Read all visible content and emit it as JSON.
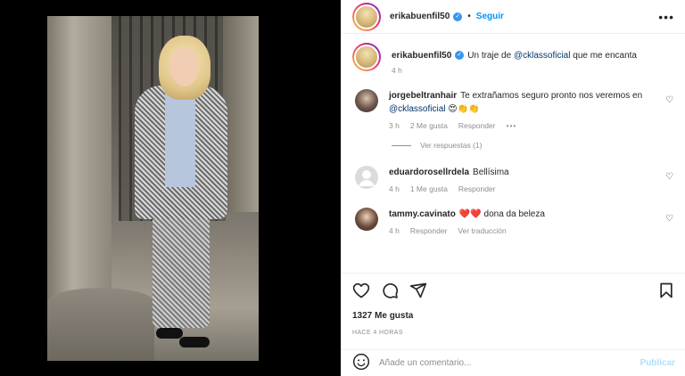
{
  "colors": {
    "accent": "#0095f6",
    "mention": "#00376b",
    "muted": "#8e8e8e",
    "heart_red": "#ed4956"
  },
  "header": {
    "username": "erikabuenfil50",
    "follow_label": "Seguir",
    "more_icon": "more-horizontal-icon"
  },
  "caption": {
    "username": "erikabuenfil50",
    "text_before": "Un traje de ",
    "mention": "@cklassoficial",
    "text_after": " que me encanta",
    "time": "4 h"
  },
  "comments": [
    {
      "username": "jorgebeltranhair",
      "text": "Te extrañamos seguro pronto nos veremos en ",
      "mention": "@cklassoficial",
      "emoji": "😍👏👏",
      "time": "3 h",
      "likes": "2 Me gusta",
      "reply": "Responder",
      "replies_label": "Ver respuestas (1)"
    },
    {
      "username": "eduardorosellrdela",
      "text": "Bellísima",
      "time": "4 h",
      "likes": "1 Me gusta",
      "reply": "Responder"
    },
    {
      "username": "tammy.cavinato",
      "emoji": "❤️❤️",
      "text": "dona da beleza",
      "time": "4 h",
      "reply": "Responder",
      "translate": "Ver traducción"
    }
  ],
  "actions": {
    "likes": "1327 Me gusta",
    "ago": "HACE 4 HORAS"
  },
  "add_comment": {
    "placeholder": "Añade un comentario...",
    "publish": "Publicar"
  }
}
